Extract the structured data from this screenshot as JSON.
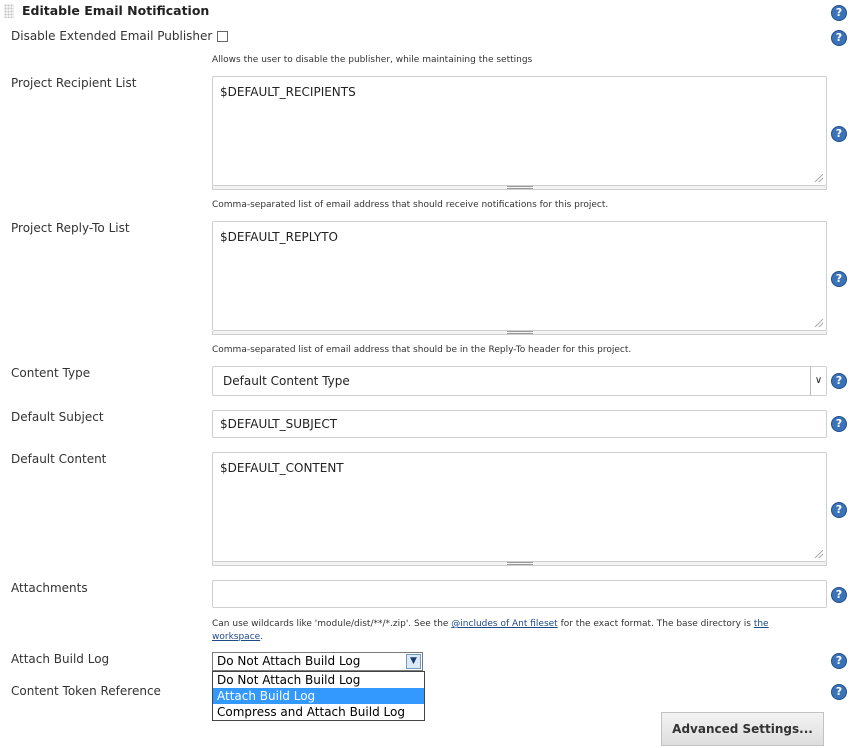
{
  "section": {
    "title": "Editable Email Notification"
  },
  "disable_publisher": {
    "label": "Disable Extended Email Publisher",
    "checked": false,
    "description": "Allows the user to disable the publisher, while maintaining the settings"
  },
  "recipient_list": {
    "label": "Project Recipient List",
    "value": "$DEFAULT_RECIPIENTS",
    "description": "Comma-separated list of email address that should receive notifications for this project."
  },
  "reply_to_list": {
    "label": "Project Reply-To List",
    "value": "$DEFAULT_REPLYTO",
    "description": "Comma-separated list of email address that should be in the Reply-To header for this project."
  },
  "content_type": {
    "label": "Content Type",
    "value": "Default Content Type"
  },
  "default_subject": {
    "label": "Default Subject",
    "value": "$DEFAULT_SUBJECT"
  },
  "default_content": {
    "label": "Default Content",
    "value": "$DEFAULT_CONTENT"
  },
  "attachments": {
    "label": "Attachments",
    "value": "",
    "desc_part1": "Can use wildcards like 'module/dist/**/*.zip'. See the ",
    "desc_link1": "@includes of Ant fileset",
    "desc_part2": " for the exact format. The base directory is ",
    "desc_link2a": "the",
    "desc_link2b": "workspace",
    "desc_part3": "."
  },
  "attach_build_log": {
    "label": "Attach Build Log",
    "selected": "Do Not Attach Build Log",
    "options": [
      "Do Not Attach Build Log",
      "Attach Build Log",
      "Compress and Attach Build Log"
    ],
    "highlighted_index": 1
  },
  "content_token_reference": {
    "label": "Content Token Reference"
  },
  "advanced_button": {
    "label": "Advanced Settings..."
  },
  "icons": {
    "help": "help-icon",
    "help_glyph": "?"
  },
  "colors": {
    "help_blue": "#3a73b8",
    "highlight": "#3399ff",
    "link": "#204a87"
  }
}
